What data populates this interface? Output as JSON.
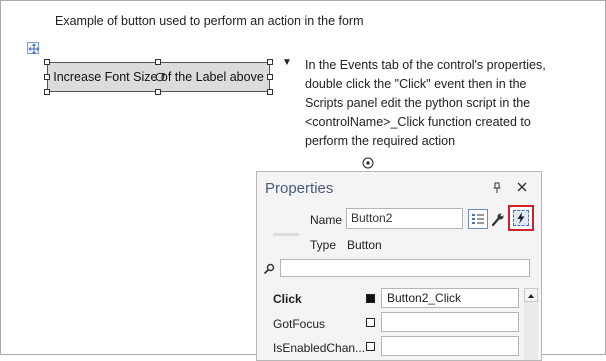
{
  "form": {
    "caption": "Example of button used to perform an action in the form",
    "button_label": "Increase Font Size of the Label above",
    "instructions": [
      "In the Events tab of the control's properties,",
      "double click the \"Click\" event then in the",
      "Scripts panel edit the python script in the",
      "<controlName>_Click function created to",
      "perform the required action"
    ]
  },
  "properties": {
    "title": "Properties",
    "name_label": "Name",
    "name_value": "Button2",
    "type_label": "Type",
    "type_value": "Button",
    "search_value": "",
    "events": [
      {
        "name": "Click",
        "value": "Button2_Click",
        "bold": true,
        "has_handler": true
      },
      {
        "name": "GotFocus",
        "value": "",
        "bold": false,
        "has_handler": false
      },
      {
        "name": "IsEnabledChan...",
        "value": "",
        "bold": false,
        "has_handler": false
      }
    ]
  },
  "icons": {
    "move": "move-handle-icon",
    "rotate": "rotate-icon",
    "menu": "dropdown-arrow-icon",
    "target": "target-icon",
    "pin": "pin-icon",
    "close": "close-icon",
    "categorized": "categorized-list-icon",
    "wrench": "wrench-icon",
    "events": "lightning-bolt-icon",
    "search": "search-icon"
  },
  "colors": {
    "events_highlight": "#d0202a",
    "title_text": "#4a5b7a"
  }
}
